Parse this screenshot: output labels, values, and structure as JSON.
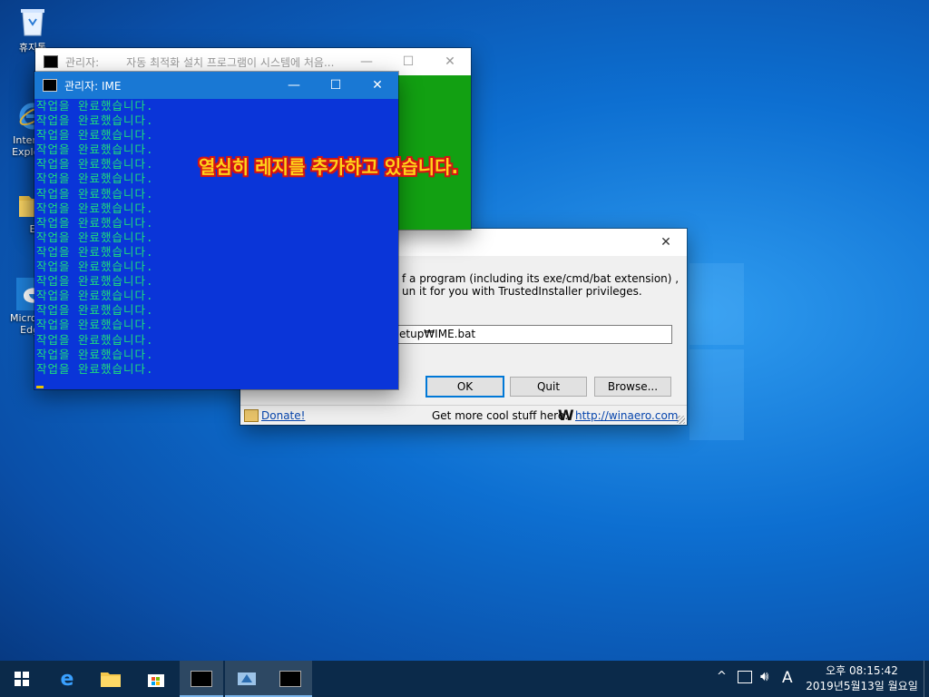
{
  "desktop": {
    "icons": [
      {
        "label": "휴지통",
        "icon": "recycle-bin-icon"
      },
      {
        "label": "Internet Explorer",
        "icon": "internet-explorer-icon"
      },
      {
        "label": "E",
        "icon": "folder-icon"
      },
      {
        "label": "Microsoft Edge",
        "icon": "edge-icon"
      }
    ]
  },
  "cmd_back": {
    "title_prefix": "관리자:",
    "title": "자동  최적화 설치 프로그램이 시스템에 처음...",
    "bg_color": "#12a012"
  },
  "cmd_front": {
    "title": "관리자:  IME",
    "bg_color": "#0a35d8",
    "text_color": "#1fe07a",
    "line_text": "작업을 완료했습니다.",
    "line_count": 19
  },
  "overlay_text": "열심히 레지를 추가하고 있습니다.",
  "dialog": {
    "desc_line1": "f a program (including its exe/cmd/bat extension) ,",
    "desc_line2": "un it for you with TrustedInstaller privileges.",
    "path_value": "etup₩IME.bat",
    "ok_label": "OK",
    "quit_label": "Quit",
    "browse_label": "Browse...",
    "donate_label": "Donate!",
    "footer_text": "Get more cool stuff here:",
    "footer_link": "http://winaero.com"
  },
  "taskbar": {
    "time": "오후 08:15:42",
    "date": "2019년5월13일 월요일",
    "ime_label": "A"
  }
}
